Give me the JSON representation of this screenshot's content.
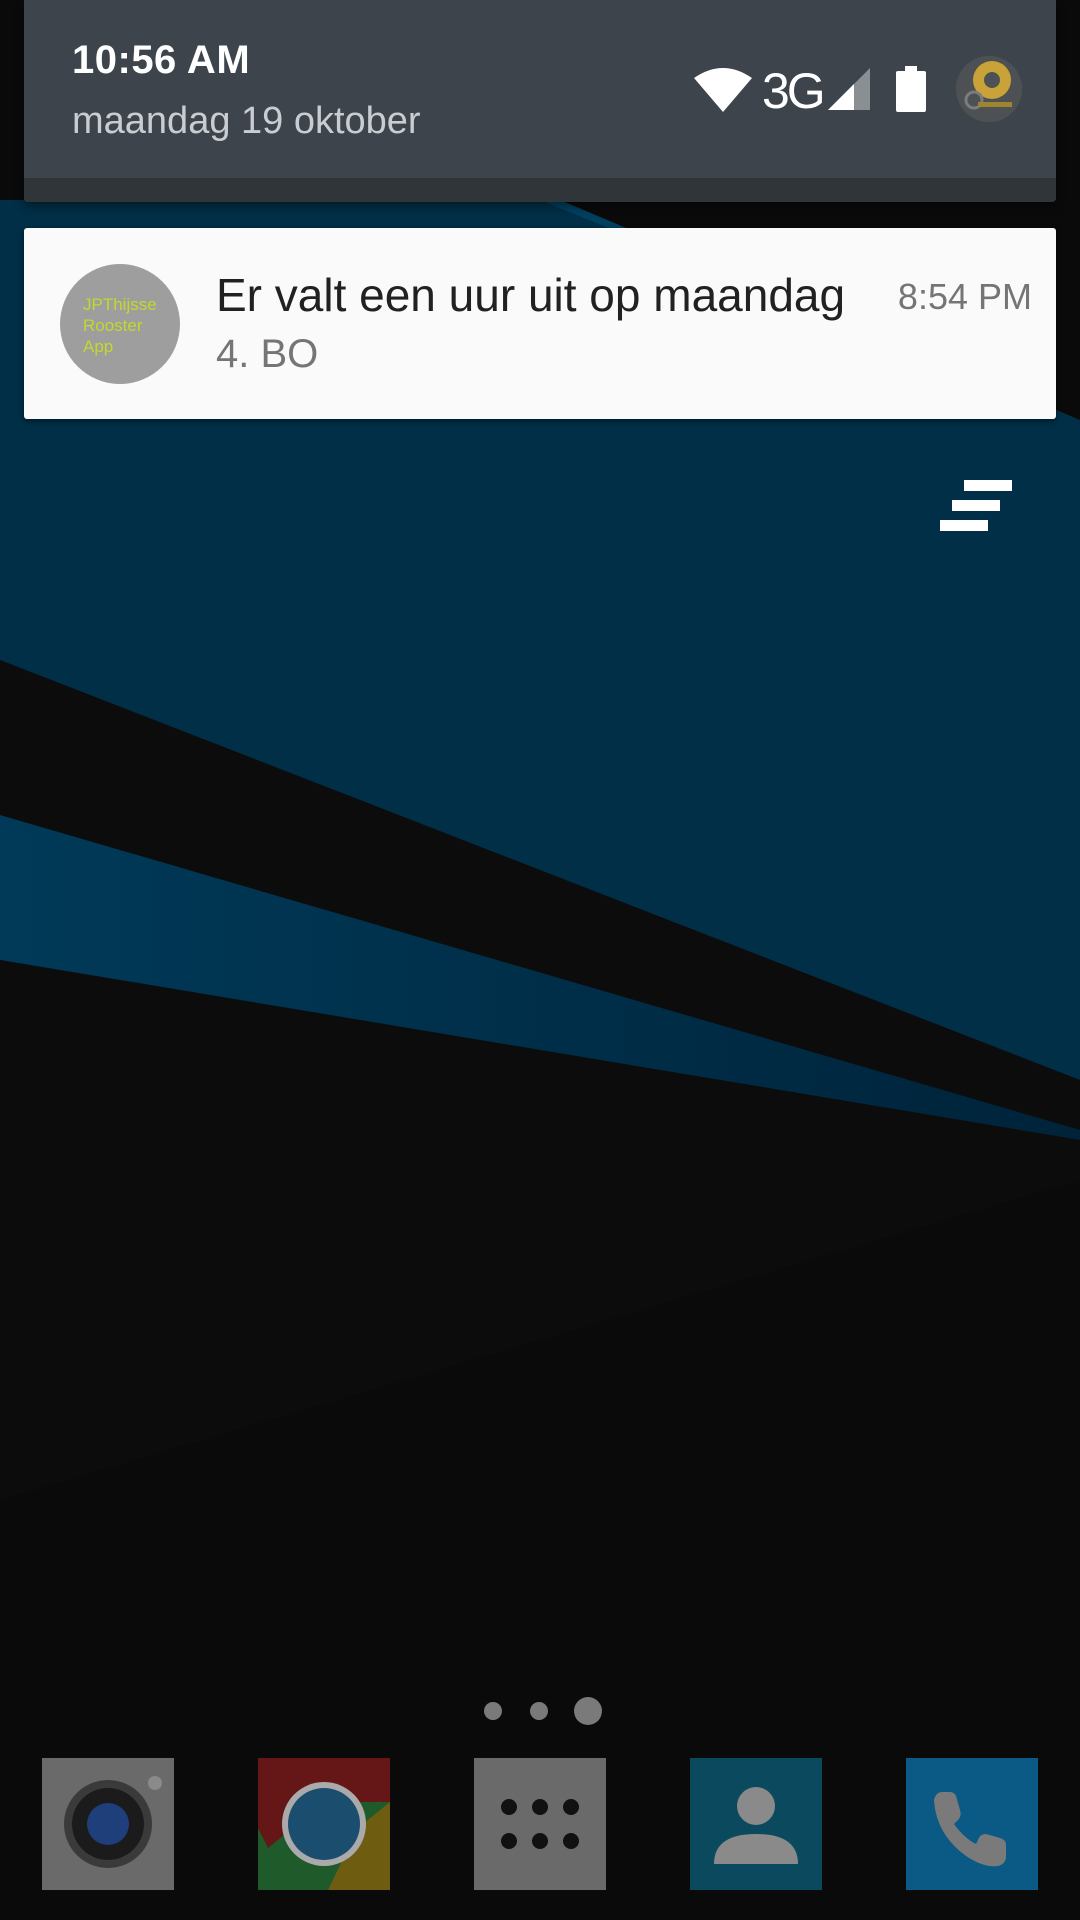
{
  "status_bar": {
    "time": "10:56 AM",
    "date": "maandag 19 oktober",
    "network_type": "3G",
    "icons": [
      "wifi-icon",
      "signal-icon",
      "battery-icon",
      "profile-avatar"
    ]
  },
  "notification": {
    "app_icon_lines": [
      "JPThijsse",
      "Rooster",
      "App"
    ],
    "title": "Er valt een uur uit op maandag",
    "time": "8:54 PM",
    "text": "4. BO"
  },
  "clear_all": {
    "icon": "clear-all-icon"
  },
  "home": {
    "page_count": 3,
    "current_page": 3
  },
  "dock": {
    "apps": [
      {
        "name": "camera",
        "icon": "camera-icon",
        "color": "#6a6a6a"
      },
      {
        "name": "chrome",
        "icon": "chrome-icon",
        "color": "#1b4d6e"
      },
      {
        "name": "app-drawer",
        "icon": "app-drawer-icon",
        "color": "#6a6a6a"
      },
      {
        "name": "contacts",
        "icon": "contacts-icon",
        "color": "#0b4a5e"
      },
      {
        "name": "phone",
        "icon": "phone-icon",
        "color": "#0a5a85"
      }
    ]
  },
  "colors": {
    "header_bg": "#3d444b",
    "card_bg": "#fafafa",
    "wallpaper_blue": "#00324b",
    "wallpaper_dark": "#0b0b0b"
  }
}
